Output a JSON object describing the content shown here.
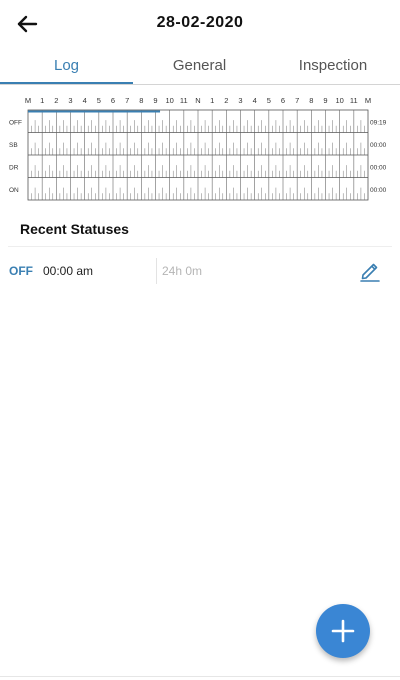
{
  "header": {
    "title": "28-02-2020",
    "back_icon": "arrow-left-icon"
  },
  "tabs": [
    {
      "label": "Log",
      "active": true
    },
    {
      "label": "General",
      "active": false
    },
    {
      "label": "Inspection",
      "active": false
    }
  ],
  "log_graph": {
    "hour_labels": [
      "M",
      "1",
      "2",
      "3",
      "4",
      "5",
      "6",
      "7",
      "8",
      "9",
      "10",
      "11",
      "N",
      "1",
      "2",
      "3",
      "4",
      "5",
      "6",
      "7",
      "8",
      "9",
      "10",
      "11",
      "M"
    ],
    "rows": [
      {
        "code": "OFF",
        "total": "09:19"
      },
      {
        "code": "SB",
        "total": "00:00"
      },
      {
        "code": "DR",
        "total": "00:00"
      },
      {
        "code": "ON",
        "total": "00:00"
      }
    ],
    "segments": [
      {
        "row": 0,
        "start_hour": 0,
        "end_hour": 9.32
      }
    ],
    "line_color": "#3a7fb2"
  },
  "recent_statuses": {
    "title": "Recent Statuses",
    "items": [
      {
        "code": "OFF",
        "time": "00:00 am",
        "duration": "24h 0m",
        "edit_icon": "pencil-icon"
      }
    ]
  },
  "fab": {
    "icon": "plus-icon",
    "color": "#3a86d4"
  },
  "colors": {
    "accent": "#3a7fb2"
  }
}
